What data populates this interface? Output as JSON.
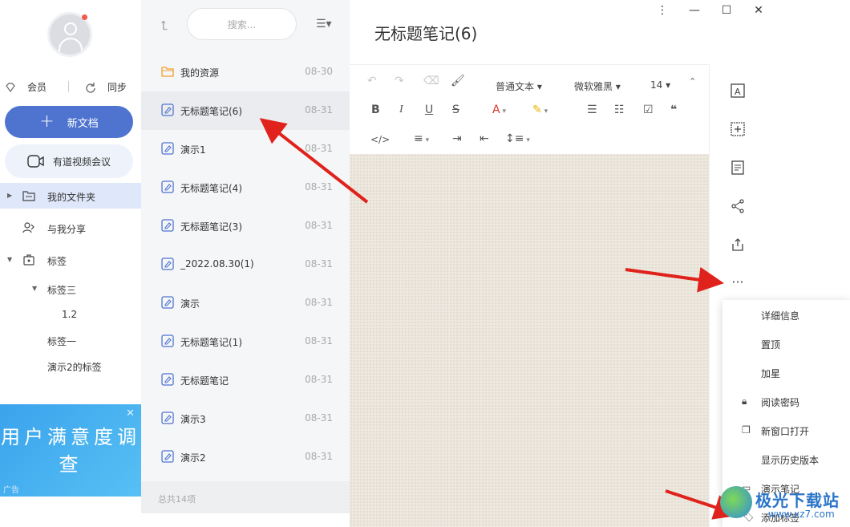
{
  "sidebar": {
    "member_label": "会员",
    "sync_label": "同步",
    "new_doc_label": "新文档",
    "video_meeting_label": "有道视频会议",
    "tree": [
      {
        "label": "我的文件夹"
      },
      {
        "label": "与我分享"
      },
      {
        "label": "标签"
      },
      {
        "label": "标签三"
      },
      {
        "label": "1.2"
      },
      {
        "label": "标签一"
      },
      {
        "label": "演示2的标签"
      }
    ],
    "ad": {
      "text": "用户满意度调查",
      "tag": "广告",
      "close": "✕"
    }
  },
  "list": {
    "search_placeholder": "搜索...",
    "items": [
      {
        "name": "我的资源",
        "date": "08-30"
      },
      {
        "name": "无标题笔记(6)",
        "date": "08-31"
      },
      {
        "name": "演示1",
        "date": "08-31"
      },
      {
        "name": "无标题笔记(4)",
        "date": "08-31"
      },
      {
        "name": "无标题笔记(3)",
        "date": "08-31"
      },
      {
        "name": "_2022.08.30(1)",
        "date": "08-31"
      },
      {
        "name": "演示",
        "date": "08-31"
      },
      {
        "name": "无标题笔记(1)",
        "date": "08-31"
      },
      {
        "name": "无标题笔记",
        "date": "08-31"
      },
      {
        "name": "演示3",
        "date": "08-31"
      },
      {
        "name": "演示2",
        "date": "08-31"
      }
    ],
    "footer": "总共14项"
  },
  "editor": {
    "title": "无标题笔记(6)",
    "toolbar": {
      "text_style": "普通文本",
      "font": "微软雅黑",
      "size": "14"
    },
    "context_menu": [
      {
        "label": "详细信息"
      },
      {
        "label": "置顶"
      },
      {
        "label": "加星"
      },
      {
        "label": "阅读密码"
      },
      {
        "label": "新窗口打开"
      },
      {
        "label": "显示历史版本"
      },
      {
        "label": "演示笔记"
      },
      {
        "label": "添加标签"
      }
    ]
  },
  "watermark": {
    "title": "极光下载站",
    "url": "www.xz7.com"
  },
  "colors": {
    "accent": "#4f74cf",
    "selected_bg": "#dfe7fa",
    "arrow": "#e0221c"
  }
}
